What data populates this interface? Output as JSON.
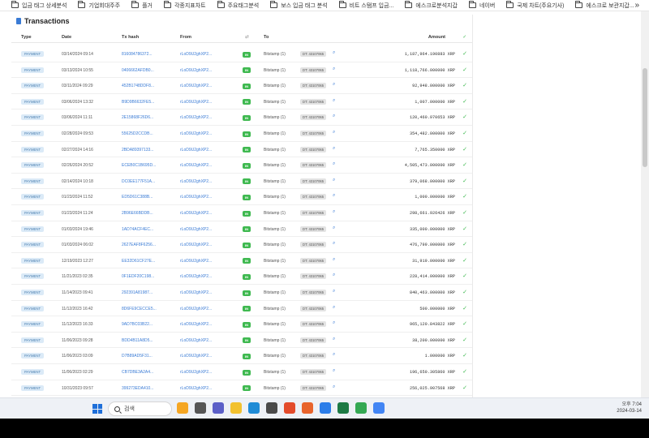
{
  "bookmarks": [
    "입금 태그 상세분석",
    "기업회대주주",
    "플거",
    "각종지표차트",
    "주요태그분석",
    "보스 입금 태그 분석",
    "비트 스탬프 입금...",
    "에스크로분석지갑",
    "네이버",
    "국제 차트(주요기사)",
    "에스크로 보관지갑..."
  ],
  "bookmarks_more": "»",
  "panel": {
    "title": "Transactions"
  },
  "columns": {
    "type": "Type",
    "date": "Date",
    "hash": "Tx hash",
    "from": "From",
    "dir_icon": "⇄",
    "to": "To",
    "amount": "Amount",
    "status_icon": "✓"
  },
  "rows": [
    {
      "type": "PAYMENT",
      "date": "03/14/2024 09:14",
      "hash": "816084786372...",
      "from": "rLoD9U2ghXP2...",
      "dir": "IN",
      "to": "Bitstamp (1)",
      "tag": "DT: 43107065",
      "amount": "1,187,964.190883 XRP"
    },
    {
      "type": "PAYMENT",
      "date": "03/13/2024 10:55",
      "hash": "0406662AFDB0...",
      "from": "rLoD9U2ghXP2...",
      "dir": "IN",
      "to": "Bitstamp (1)",
      "tag": "DT: 43107065",
      "amount": "1,118,766.000000 XRP"
    },
    {
      "type": "PAYMENT",
      "date": "03/11/2024 09:29",
      "hash": "452B1748DDF8...",
      "from": "rLoD9U2ghXP2...",
      "dir": "IN",
      "to": "Bitstamp (1)",
      "tag": "DT: 43107065",
      "amount": "92,948.000000 XRP"
    },
    {
      "type": "PAYMENT",
      "date": "03/06/2024 13:32",
      "hash": "B9D9B6632FE5...",
      "from": "rLoD9U2ghXP2...",
      "dir": "IN",
      "to": "Bitstamp (1)",
      "tag": "DT: 43107065",
      "amount": "1,007.000000 XRP"
    },
    {
      "type": "PAYMENT",
      "date": "03/06/2024 11:11",
      "hash": "2E15868F26D6...",
      "from": "rLoD9U2ghXP2...",
      "dir": "IN",
      "to": "Bitstamp (1)",
      "tag": "DT: 43107065",
      "amount": "120,460.970653 XRP"
    },
    {
      "type": "PAYMENT",
      "date": "02/28/2024 09:53",
      "hash": "55625D2CCDB...",
      "from": "rLoD9U2ghXP2...",
      "dir": "IN",
      "to": "Bitstamp (1)",
      "tag": "DT: 43107065",
      "amount": "354,482.000000 XRP"
    },
    {
      "type": "PAYMENT",
      "date": "02/27/2024 14:16",
      "hash": "2BDA89397133...",
      "from": "rLoD9U2ghXP2...",
      "dir": "IN",
      "to": "Bitstamp (1)",
      "tag": "DT: 43107065",
      "amount": "7,765.350000 XRP"
    },
    {
      "type": "PAYMENT",
      "date": "02/26/2024 20:52",
      "hash": "ECEB0C1B695D...",
      "from": "rLoD9U2ghXP2...",
      "dir": "IN",
      "to": "Bitstamp (1)",
      "tag": "DT: 43107065",
      "amount": "4,505,473.000000 XRP"
    },
    {
      "type": "PAYMENT",
      "date": "02/14/2024 10:18",
      "hash": "DC0EE177F51A...",
      "from": "rLoD9U2ghXP2...",
      "dir": "IN",
      "to": "Bitstamp (1)",
      "tag": "DT: 43107065",
      "amount": "379,068.000000 XRP"
    },
    {
      "type": "PAYMENT",
      "date": "01/23/2024 11:52",
      "hash": "ED5D61C388B...",
      "from": "rLoD9U2ghXP2...",
      "dir": "IN",
      "to": "Bitstamp (1)",
      "tag": "DT: 43107065",
      "amount": "1,000.000000 XRP"
    },
    {
      "type": "PAYMENT",
      "date": "01/23/2024 11:24",
      "hash": "2B96E66BDDB...",
      "from": "rLoD9U2ghXP2...",
      "dir": "IN",
      "to": "Bitstamp (1)",
      "tag": "DT: 43107065",
      "amount": "298,661.926426 XRP"
    },
    {
      "type": "PAYMENT",
      "date": "01/03/2024 19:46",
      "hash": "1AD74ACF4EC...",
      "from": "rLoD9U2ghXP2...",
      "dir": "IN",
      "to": "Bitstamp (1)",
      "tag": "DT: 43107065",
      "amount": "335,000.000000 XRP"
    },
    {
      "type": "PAYMENT",
      "date": "01/03/2024 06:02",
      "hash": "2627EAF8F6256...",
      "from": "rLoD9U2ghXP2...",
      "dir": "IN",
      "to": "Bitstamp (1)",
      "tag": "DT: 43107065",
      "amount": "476,799.000000 XRP"
    },
    {
      "type": "PAYMENT",
      "date": "12/19/2023 12:27",
      "hash": "EE32D61CF27E...",
      "from": "rLoD9U2ghXP2...",
      "dir": "IN",
      "to": "Bitstamp (1)",
      "tag": "DT: 43107065",
      "amount": "31,919.000000 XRP"
    },
    {
      "type": "PAYMENT",
      "date": "11/21/2023 02:35",
      "hash": "0F1EDF20C198...",
      "from": "rLoD9U2ghXP2...",
      "dir": "IN",
      "to": "Bitstamp (1)",
      "tag": "DT: 43107065",
      "amount": "228,414.000000 XRP"
    },
    {
      "type": "PAYMENT",
      "date": "11/14/2023 09:41",
      "hash": "292391A81987...",
      "from": "rLoD9U2ghXP2...",
      "dir": "IN",
      "to": "Bitstamp (1)",
      "tag": "DT: 43107065",
      "amount": "840,463.000000 XRP"
    },
    {
      "type": "PAYMENT",
      "date": "11/12/2023 16:42",
      "hash": "8D6FE9CECCE5...",
      "from": "rLoD9U2ghXP2...",
      "dir": "IN",
      "to": "Bitstamp (1)",
      "tag": "DT: 43107065",
      "amount": "500.000000 XRP"
    },
    {
      "type": "PAYMENT",
      "date": "11/12/2023 16:33",
      "hash": "9AD7BC03B22...",
      "from": "rLoD9U2ghXP2...",
      "dir": "IN",
      "to": "Bitstamp (1)",
      "tag": "DT: 43107065",
      "amount": "965,120.843822 XRP"
    },
    {
      "type": "PAYMENT",
      "date": "11/06/2023 09:28",
      "hash": "BDD4B11A8D5...",
      "from": "rLoD9U2ghXP2...",
      "dir": "IN",
      "to": "Bitstamp (1)",
      "tag": "DT: 43107065",
      "amount": "38,200.000000 XRP"
    },
    {
      "type": "PAYMENT",
      "date": "11/06/2023 03:09",
      "hash": "D7B89AD5F31...",
      "from": "rLoD9U2ghXP2...",
      "dir": "IN",
      "to": "Bitstamp (1)",
      "tag": "DT: 43107065",
      "amount": "1.000000 XRP"
    },
    {
      "type": "PAYMENT",
      "date": "11/06/2023 02:29",
      "hash": "CB7DBE3A2A4...",
      "from": "rLoD9U2ghXP2...",
      "dir": "IN",
      "to": "Bitstamp (1)",
      "tag": "DT: 43107065",
      "amount": "196,650.305860 XRP"
    },
    {
      "type": "PAYMENT",
      "date": "10/31/2023 09:57",
      "hash": "399273EDA410...",
      "from": "rLoD9U2ghXP2...",
      "dir": "IN",
      "to": "Bitstamp (1)",
      "tag": "DT: 43107065",
      "amount": "256,025.907568 XRP"
    }
  ],
  "taskbar": {
    "search_placeholder": "검색",
    "time": "오후 7:04",
    "date": "2024-03-14",
    "icons": [
      "weather-icon",
      "task-view-icon",
      "chat-icon",
      "file-explorer-icon",
      "edge-icon",
      "store-icon",
      "app-icon",
      "app-icon",
      "app-icon",
      "excel-icon",
      "chrome-icon",
      "app-icon"
    ]
  },
  "colors": {
    "accent": "#3a7bd5",
    "in_badge": "#3fb950",
    "type_badge": "#dbeaf7"
  }
}
